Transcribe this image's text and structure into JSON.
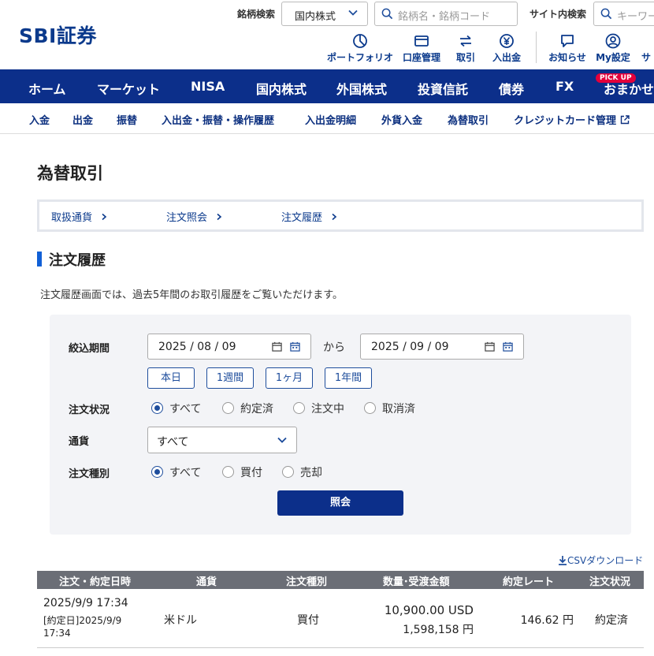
{
  "header": {
    "logo": "SBI証券",
    "brand_search_label": "銘柄検索",
    "market_select": "国内株式",
    "brand_search_placeholder": "銘柄名・銘柄コード",
    "site_search_label": "サイト内検索",
    "site_search_placeholder": "キーワー",
    "tools": [
      {
        "label": "ポートフォリオ",
        "icon": "portfolio-icon"
      },
      {
        "label": "口座管理",
        "icon": "card-icon"
      },
      {
        "label": "取引",
        "icon": "swap-arrows-icon"
      },
      {
        "label": "入出金",
        "icon": "yen-icon"
      },
      {
        "label": "お知らせ",
        "icon": "chat-bubble-icon"
      },
      {
        "label": "My設定",
        "icon": "user-icon"
      },
      {
        "label": "サ",
        "icon": ""
      }
    ]
  },
  "main_nav": {
    "items": [
      "ホーム",
      "マーケット",
      "NISA",
      "国内株式",
      "外国株式",
      "投資信託",
      "債券",
      "FX",
      "おまかせ"
    ],
    "pickup_badge": "PICK UP"
  },
  "sub_nav": {
    "items": [
      "入金",
      "出金",
      "振替",
      "入出金・振替・操作履歴",
      "入出金明細",
      "外貨入金",
      "為替取引",
      "クレジットカード管理"
    ]
  },
  "page": {
    "title": "為替取引",
    "crumbs": [
      "取扱通貨",
      "注文照会",
      "注文履歴"
    ],
    "section_title": "注文履歴",
    "description": "注文履歴画面では、過去5年間のお取引履歴をご覧いただけます。"
  },
  "filter": {
    "period_label": "絞込期間",
    "date_from": "2025 / 08 / 09",
    "date_separator": "から",
    "date_to": "2025 / 09 / 09",
    "quick_buttons": [
      "本日",
      "1週間",
      "1ヶ月",
      "1年間"
    ],
    "status_label": "注文状況",
    "status_options": [
      "すべて",
      "約定済",
      "注文中",
      "取消済"
    ],
    "status_selected": "すべて",
    "currency_label": "通貨",
    "currency_value": "すべて",
    "type_label": "注文種別",
    "type_options": [
      "すべて",
      "買付",
      "売却"
    ],
    "type_selected": "すべて",
    "submit_label": "照会"
  },
  "csv_download": "CSVダウンロード",
  "table": {
    "headers": [
      "注文・約定日時",
      "通貨",
      "注文種別",
      "数量･受渡金額",
      "約定レート",
      "注文状況"
    ],
    "rows": [
      {
        "order_datetime": "2025/9/9 17:34",
        "exec_line1": "[約定日]2025/9/9",
        "exec_line2": "17:34",
        "currency": "米ドル",
        "type": "買付",
        "quantity": "10,900.00 USD",
        "amount": "1,598,158 円",
        "rate": "146.62 円",
        "status": "約定済"
      }
    ]
  },
  "colors": {
    "brand_navy": "#0c2f8a",
    "link_blue": "#1e4d9c",
    "section_accent": "#1160d6",
    "table_header": "#6b6e76",
    "pickup_red": "#e4003b"
  }
}
